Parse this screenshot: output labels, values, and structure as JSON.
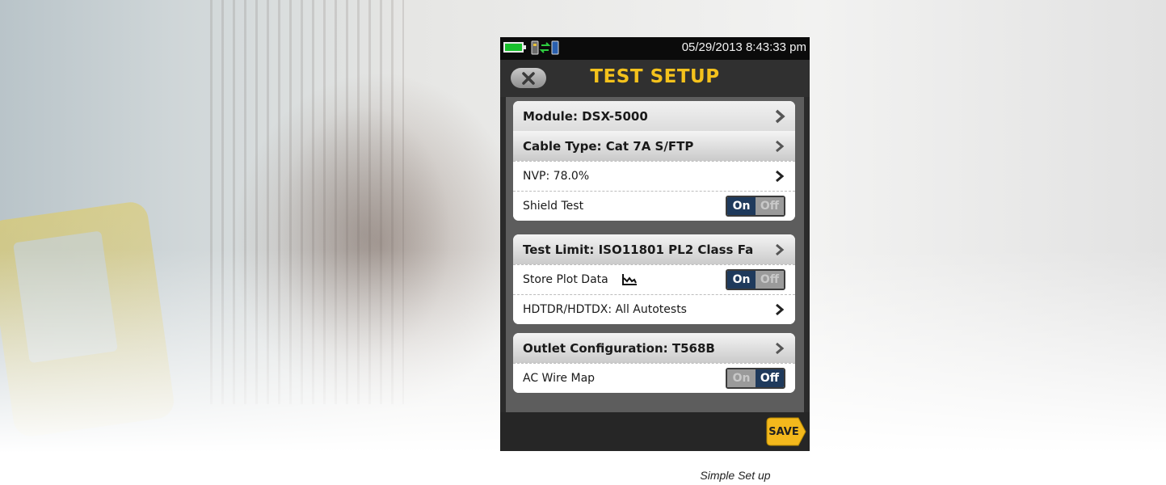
{
  "status_bar": {
    "datetime": "05/29/2013 8:43:33 pm",
    "battery_icon": "battery-icon",
    "connection_icon": "network-link-icon"
  },
  "header": {
    "title": "TEST SETUP",
    "back_icon": "back-x-icon"
  },
  "groups": [
    {
      "rows": [
        {
          "label": "Module: DSX-5000",
          "type": "nav"
        },
        {
          "label": "Cable Type: Cat 7A S/FTP",
          "type": "nav"
        },
        {
          "label": "NVP: 78.0%",
          "type": "nav"
        },
        {
          "label": "Shield Test",
          "type": "toggle",
          "on_label": "On",
          "off_label": "Off",
          "state": "on"
        }
      ]
    },
    {
      "rows": [
        {
          "label": "Test Limit: ISO11801 PL2 Class Fa",
          "type": "nav"
        },
        {
          "label": "Store Plot Data",
          "type": "toggle",
          "icon": "plot-graph-icon",
          "on_label": "On",
          "off_label": "Off",
          "state": "on"
        },
        {
          "label": "HDTDR/HDTDX: All Autotests",
          "type": "nav"
        }
      ]
    },
    {
      "rows": [
        {
          "label": "Outlet Configuration: T568B",
          "type": "nav"
        },
        {
          "label": "AC Wire Map",
          "type": "toggle",
          "on_label": "On",
          "off_label": "Off",
          "state": "off"
        }
      ]
    }
  ],
  "footer": {
    "save_label": "SAVE"
  },
  "caption": "Simple Set up",
  "colors": {
    "title": "#f4c21c",
    "toggle_active": "#1f3a5c",
    "save_button": "#f3b81c",
    "battery": "#18c02c"
  }
}
